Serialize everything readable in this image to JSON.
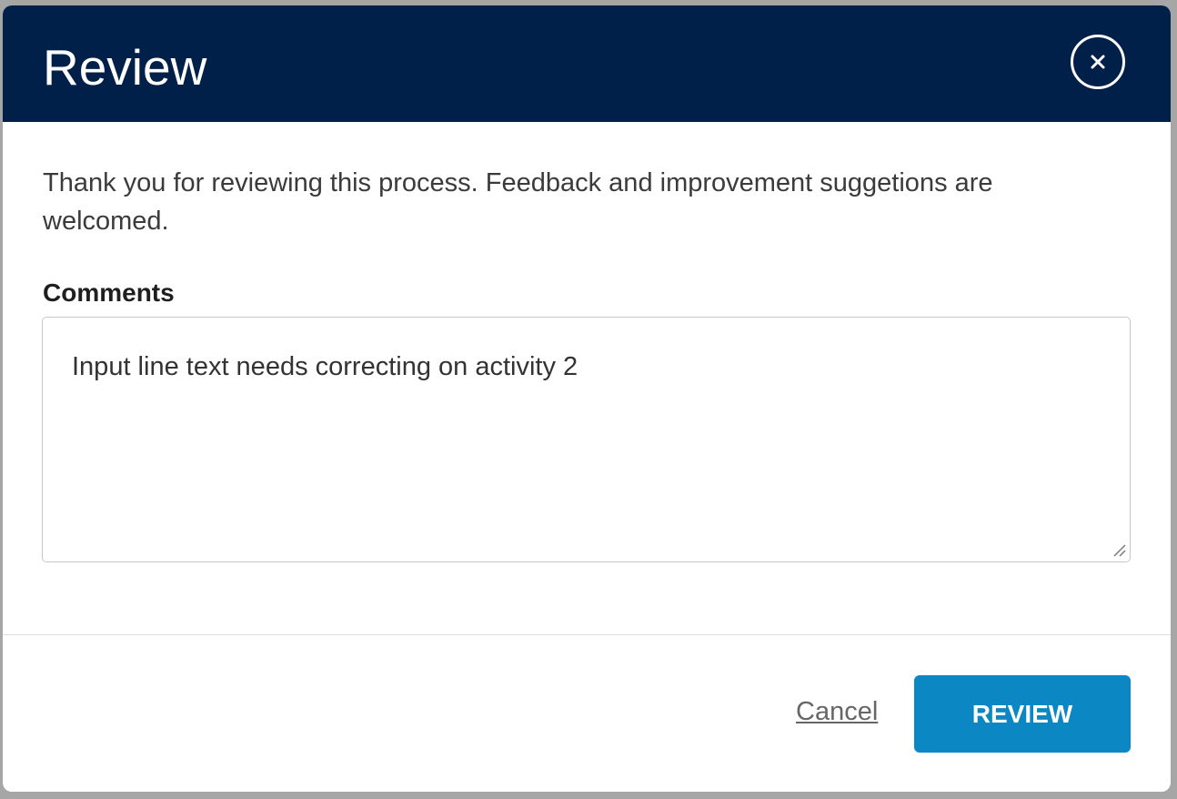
{
  "dialog": {
    "title": "Review",
    "close_icon": "close-icon",
    "intro_text": "Thank you for reviewing this process. Feedback and improvement suggetions are welcomed.",
    "comments": {
      "label": "Comments",
      "value": "Input line text needs correcting on activity 2"
    },
    "footer": {
      "cancel_label": "Cancel",
      "submit_label": "REVIEW"
    }
  },
  "colors": {
    "header_background": "#00204a",
    "primary_button": "#0b88c4",
    "backdrop": "#a6a6a6"
  }
}
